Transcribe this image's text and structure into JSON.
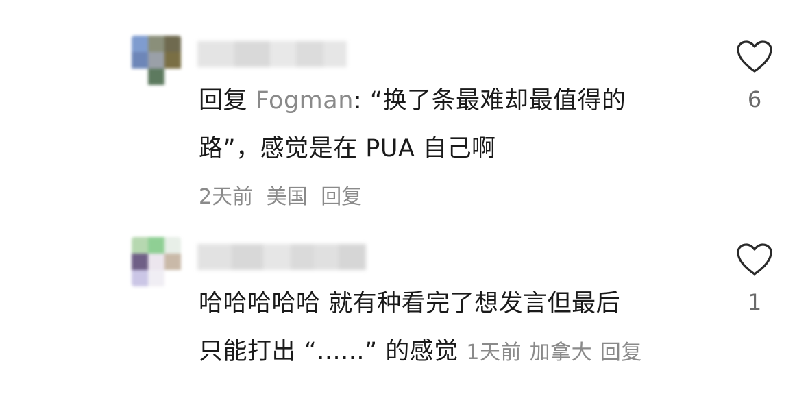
{
  "comments": [
    {
      "reply_prefix": "回复",
      "mention": "Fogman",
      "text_line1": ": “换了条最难却最值得的",
      "text_line2": "路”，感觉是在 PUA 自己啊",
      "time": "2天前",
      "location": "美国",
      "reply_label": "回复",
      "like_count": "6",
      "like_icon": "heart-outline-icon",
      "username_blurred": true
    },
    {
      "text_line1": "哈哈哈哈哈 就有种看完了想发言但最后",
      "text_line2": "只能打出 “......” 的感觉",
      "time": "1天前",
      "location": "加拿大",
      "reply_label": "回复",
      "like_count": "1",
      "like_icon": "heart-outline-icon",
      "username_blurred": true
    }
  ],
  "colors": {
    "text": "#1a1a1a",
    "secondary": "#8a8a8a",
    "like_count": "#6b6b6b",
    "background": "#ffffff"
  }
}
